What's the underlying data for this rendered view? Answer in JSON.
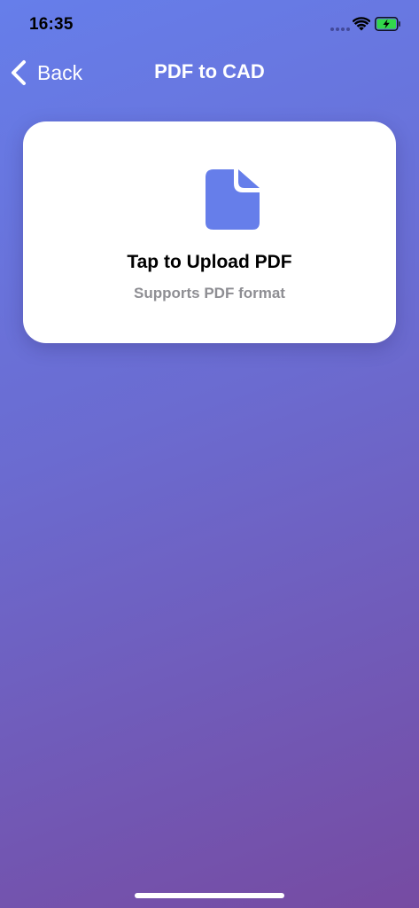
{
  "status_bar": {
    "time": "16:35"
  },
  "nav": {
    "back_label": "Back",
    "title": "PDF to CAD"
  },
  "upload_card": {
    "title": "Tap to Upload PDF",
    "subtitle": "Supports PDF format",
    "icon": "document-icon"
  },
  "colors": {
    "gradient_start": "#667eea",
    "gradient_end": "#764ba2",
    "accent": "#667eea",
    "battery_fill": "#32d74b",
    "card_background": "#ffffff",
    "subtitle_text": "#8e8e93"
  },
  "battery": {
    "charging": true
  }
}
